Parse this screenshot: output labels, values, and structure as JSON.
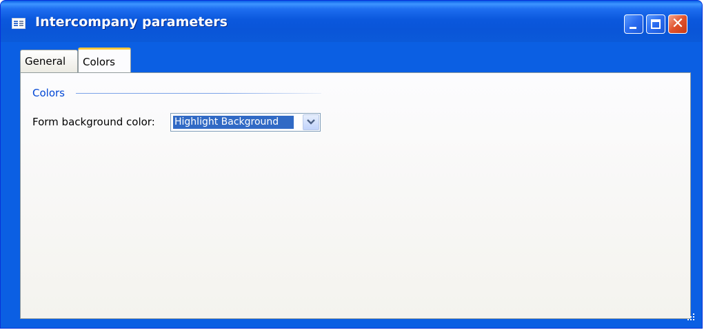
{
  "window": {
    "title": "Intercompany parameters",
    "controls": [
      "minimize-icon",
      "maximize-icon",
      "close-icon"
    ]
  },
  "tabs": [
    {
      "label": "General",
      "selected": false
    },
    {
      "label": "Colors",
      "selected": true
    }
  ],
  "panel": {
    "group_label": "Colors",
    "field_label": "Form background color:",
    "select_value": "Highlight Background"
  },
  "colors": {
    "title_bar": "#0b58dd",
    "accent_tab": "#ffc83c",
    "group_label": "#0046d5",
    "selection": "#316ac5",
    "close_button": "#e0522c"
  }
}
